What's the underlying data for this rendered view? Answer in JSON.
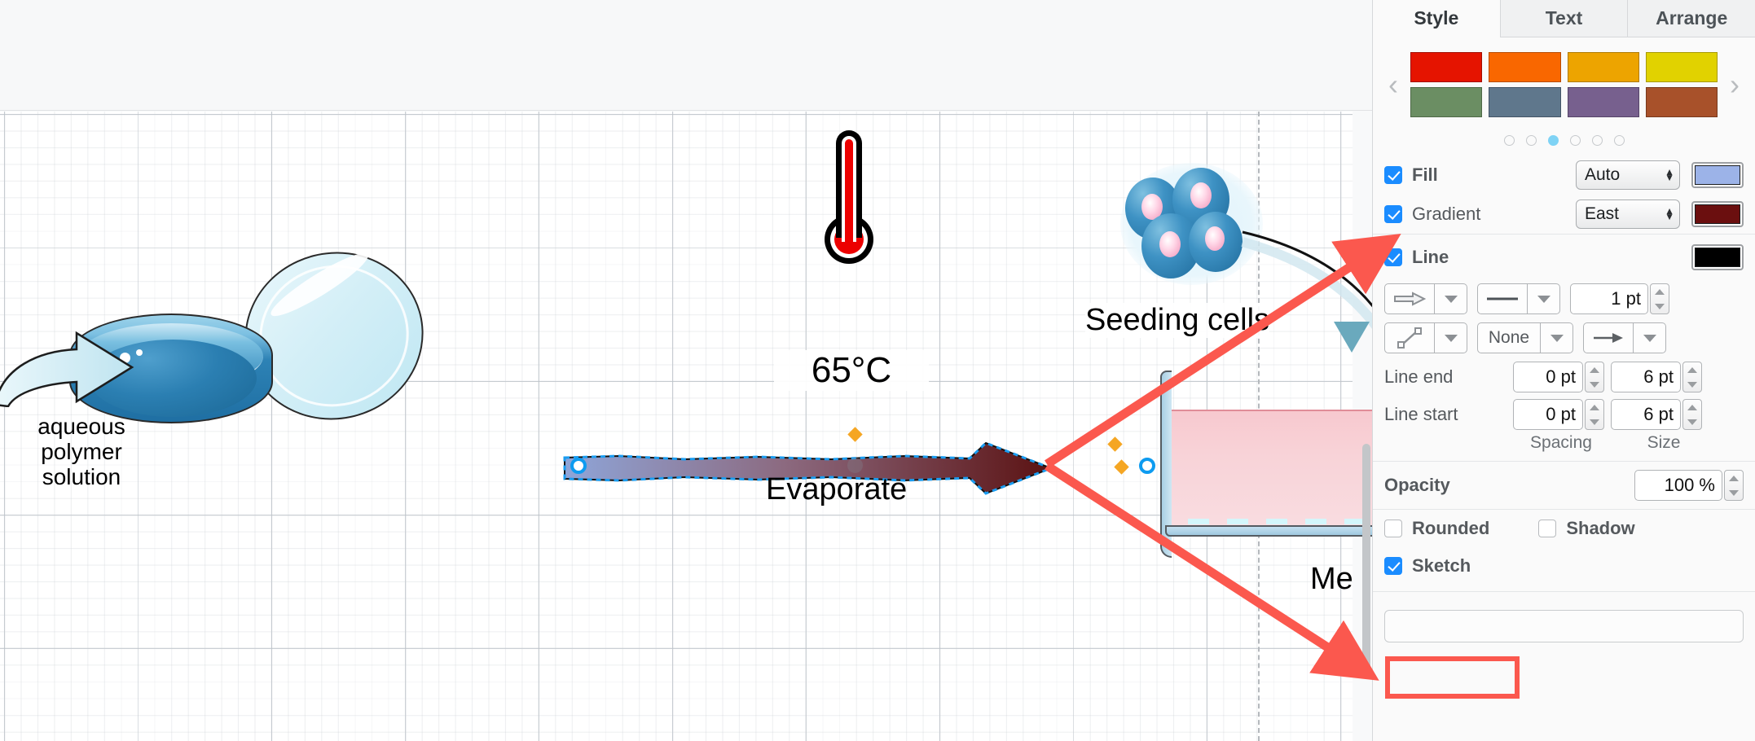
{
  "canvas": {
    "petri_label": "aqueous\npolymer\nsolution",
    "petri_label_lines": [
      "aqueous",
      "polymer",
      "solution"
    ],
    "temperature_label": "65°C",
    "evaporate_label": "Evaporate",
    "seeding_cells_label": "Seeding cells",
    "medium_label": "Me",
    "selected_shape": "evaporate-arrow"
  },
  "panel": {
    "tabs": [
      {
        "label": "Style",
        "active": true
      },
      {
        "label": "Text",
        "active": false
      },
      {
        "label": "Arrange",
        "active": false
      }
    ],
    "swatches": {
      "prev_arrow": "‹",
      "next_arrow": "›",
      "colors": [
        "#e51400",
        "#f96700",
        "#eda400",
        "#e1d200",
        "#6b8e63",
        "#5f778c",
        "#77608e",
        "#a8512a"
      ],
      "page_count": 6,
      "active_page": 3
    },
    "fill": {
      "label": "Fill",
      "checked": true,
      "select_value": "Auto",
      "color": "#9cb3e8"
    },
    "gradient": {
      "label": "Gradient",
      "checked": true,
      "select_value": "East",
      "color": "#6b0f0f"
    },
    "line": {
      "label": "Line",
      "checked": true,
      "color": "#000000",
      "width_value": "1 pt",
      "end_style_value": "None",
      "line_end": {
        "label": "Line end",
        "spacing": "0 pt",
        "size": "6 pt"
      },
      "line_start": {
        "label": "Line start",
        "spacing": "0 pt",
        "size": "6 pt"
      },
      "spacing_header": "Spacing",
      "size_header": "Size"
    },
    "opacity": {
      "label": "Opacity",
      "value": "100 %"
    },
    "rounded": {
      "label": "Rounded",
      "checked": false
    },
    "shadow": {
      "label": "Shadow",
      "checked": false
    },
    "sketch": {
      "label": "Sketch",
      "checked": true,
      "highlighted": true
    }
  },
  "annotation": {
    "color": "#fb584e",
    "arrow_count": 2,
    "highlight_target": "sketch-checkbox"
  }
}
